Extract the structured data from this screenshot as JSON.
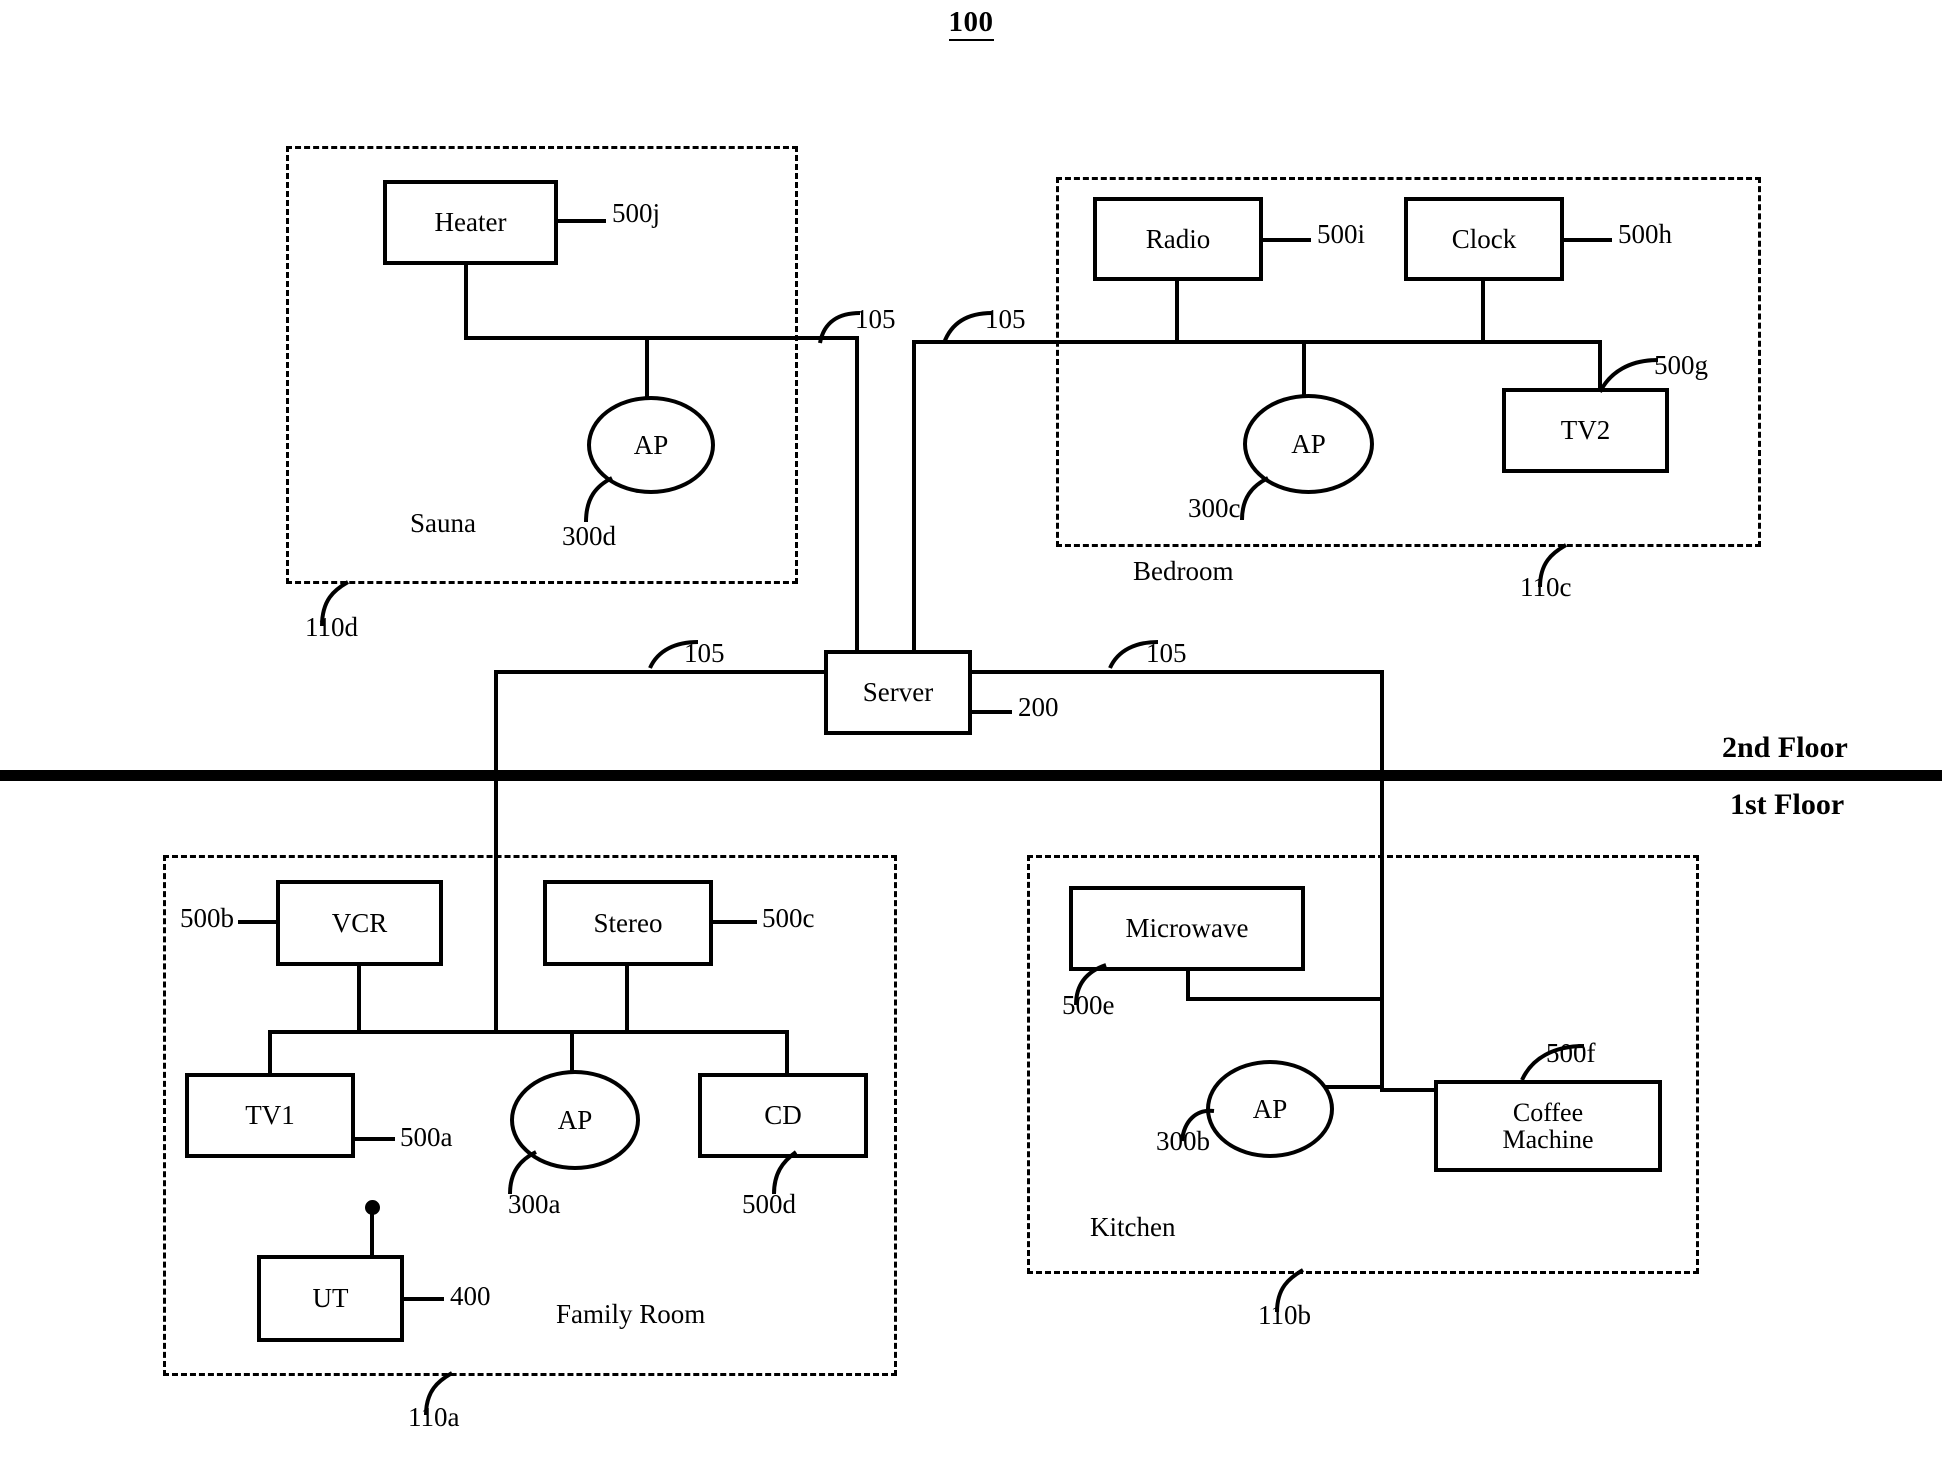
{
  "figure": {
    "number": "100"
  },
  "floors": {
    "upper_label": "2nd Floor",
    "lower_label": "1st Floor"
  },
  "server": {
    "label": "Server",
    "ref": "200"
  },
  "network_refs": {
    "sauna_link": "105",
    "bedroom_link": "105",
    "family_link": "105",
    "kitchen_link": "105"
  },
  "rooms": [
    {
      "id": "sauna",
      "name": "Sauna",
      "ref": "110d",
      "devices": [
        {
          "name": "Heater",
          "ref": "500j"
        }
      ],
      "access_point": {
        "label": "AP",
        "ref": "300d"
      }
    },
    {
      "id": "bedroom",
      "name": "Bedroom",
      "ref": "110c",
      "devices": [
        {
          "name": "Radio",
          "ref": "500i"
        },
        {
          "name": "Clock",
          "ref": "500h"
        },
        {
          "name": "TV2",
          "ref": "500g"
        }
      ],
      "access_point": {
        "label": "AP",
        "ref": "300c"
      }
    },
    {
      "id": "family-room",
      "name": "Family Room",
      "ref": "110a",
      "devices": [
        {
          "name": "VCR",
          "ref": "500b"
        },
        {
          "name": "Stereo",
          "ref": "500c"
        },
        {
          "name": "TV1",
          "ref": "500a"
        },
        {
          "name": "CD",
          "ref": "500d"
        },
        {
          "name": "UT",
          "ref": "400"
        }
      ],
      "access_point": {
        "label": "AP",
        "ref": "300a"
      }
    },
    {
      "id": "kitchen",
      "name": "Kitchen",
      "ref": "110b",
      "devices": [
        {
          "name": "Microwave",
          "ref": "500e"
        },
        {
          "name": "Coffee",
          "name2": "Machine",
          "ref": "500f"
        }
      ],
      "access_point": {
        "label": "AP",
        "ref": "300b"
      }
    }
  ]
}
